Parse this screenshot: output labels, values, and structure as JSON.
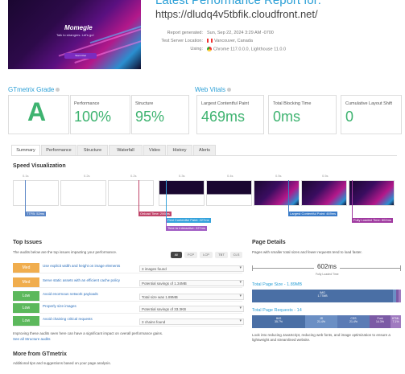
{
  "header": {
    "title": "Latest Performance Report for:",
    "url": "https://dludq4v5tbfik.cloudfront.net/",
    "thumb_title": "Momegle",
    "thumb_tagline": "Talk to strangers. Let's go!",
    "thumb_button": "Start Chat",
    "meta": [
      {
        "key": "Report generated:",
        "value": "Sun, Sep 22, 2024 3:29 AM -0700"
      },
      {
        "key": "Test Server Location:",
        "value": "Vancouver, Canada"
      },
      {
        "key": "Using:",
        "value": "Chrome 117.0.0.0, Lighthouse 11.0.0"
      }
    ]
  },
  "grade": {
    "label": "GTmetrix Grade",
    "letter": "A",
    "performance_label": "Performance",
    "performance_value": "100%",
    "structure_label": "Structure",
    "structure_value": "95%"
  },
  "vitals": {
    "label": "Web Vitals",
    "lcp_label": "Largest Contentful Paint",
    "lcp_value": "469ms",
    "tbt_label": "Total Blocking Time",
    "tbt_value": "0ms",
    "cls_label": "Cumulative Layout Shift",
    "cls_value": "0"
  },
  "tabs": [
    "Summary",
    "Performance",
    "Structure",
    "Waterfall",
    "Video",
    "History",
    "Alerts"
  ],
  "speed_viz": {
    "title": "Speed Visualization",
    "ticks": [
      "0.1s",
      "0.2s",
      "0.2s",
      "0.3s",
      "0.4s",
      "0.5s",
      "0.5s"
    ],
    "markers": [
      {
        "label": "TTFB: 52ms",
        "color": "#5b86c6"
      },
      {
        "label": "Onload Time: 206ms",
        "color": "#c0456a"
      },
      {
        "label": "First Contentful Paint: 227ms",
        "color": "#35a3dc"
      },
      {
        "label": "Time to Interactive: 227ms",
        "color": "#a05bc4"
      },
      {
        "label": "Largest Contentful Paint: 469ms",
        "color": "#3a7bc8"
      },
      {
        "label": "Fully Loaded Time: 602ms",
        "color": "#a03aa0"
      }
    ]
  },
  "top_issues": {
    "title": "Top Issues",
    "subtitle": "The audits below are the top issues impacting your performance.",
    "filters": [
      "All",
      "FCP",
      "LCP",
      "TBT",
      "CLS"
    ],
    "items": [
      {
        "severity": "Med",
        "text": "Use explicit width and height on image elements",
        "value": "3 images found"
      },
      {
        "severity": "Med",
        "text": "Serve static assets with an efficient cache policy",
        "value": "Potential savings of 1.34MB"
      },
      {
        "severity": "Low",
        "text": "Avoid enormous network payloads",
        "value": "Total size was 1.89MB"
      },
      {
        "severity": "Low",
        "text": "Properly size images",
        "value": "Potential savings of 33.3KB"
      },
      {
        "severity": "Low",
        "text": "Avoid chaining critical requests",
        "value": "3 chains found"
      }
    ],
    "footer": "Improving these audits seen here can have a significant impact on overall performance gains.",
    "footer_link": "See all Structure audits"
  },
  "more": {
    "title": "More from GTmetrix",
    "subtitle": "Additional tips and suggestions based on your page analysis."
  },
  "page_details": {
    "title": "Page Details",
    "subtitle": "Pages with smaller total sizes and fewer requests tend to load faster.",
    "fully_loaded": "602ms",
    "fully_loaded_label": "Fully Loaded Time",
    "size_label": "Total Page Size - 1.89MB",
    "requests_label": "Total Page Requests - 14",
    "size_seg_label": "IMG",
    "size_seg_value": "1.77MB",
    "requests": [
      {
        "label": "IMG",
        "value": "35.7%",
        "color": "#4a6fa5"
      },
      {
        "label": "JS",
        "value": "21.4%",
        "color": "#6b8fc4"
      },
      {
        "label": "CSS",
        "value": "21.4%",
        "color": "#5b7bb5"
      },
      {
        "label": "Font",
        "value": "14.3%",
        "color": "#7b5aa5"
      },
      {
        "label": "HTML",
        "value": "7.1%",
        "color": "#a07bc0"
      }
    ],
    "note": "Look into reducing JavaScript, reducing web fonts, and image optimization to ensure a lightweight and streamlined website."
  }
}
